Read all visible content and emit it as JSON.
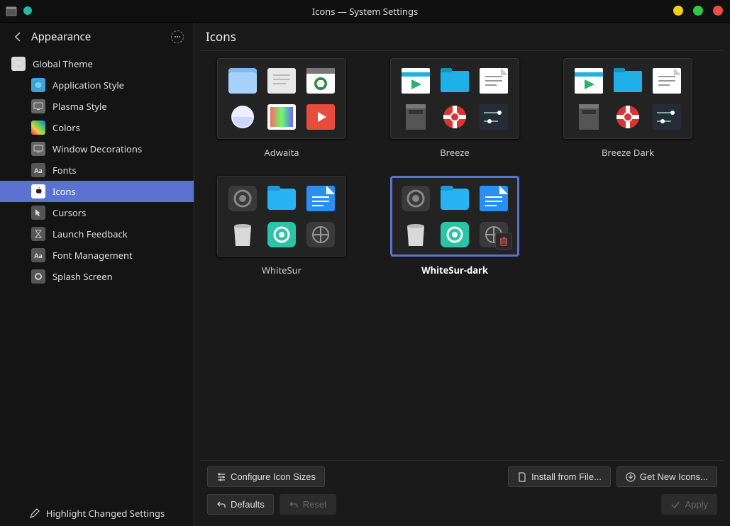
{
  "window": {
    "title": "Icons — System Settings",
    "buttons": {
      "minimize_color": "#f2ce1b",
      "maximize_color": "#33c748",
      "close_color": "#ee4b43"
    }
  },
  "sidebar": {
    "header_title": "Appearance",
    "footer_label": "Highlight Changed Settings",
    "items": [
      {
        "id": "global-theme",
        "label": "Global Theme",
        "child": false,
        "icon": "monitor"
      },
      {
        "id": "application-style",
        "label": "Application Style",
        "child": true,
        "icon": "cube"
      },
      {
        "id": "plasma-style",
        "label": "Plasma Style",
        "child": true,
        "icon": "monitor-gray"
      },
      {
        "id": "colors",
        "label": "Colors",
        "child": true,
        "icon": "rainbow"
      },
      {
        "id": "window-decorations",
        "label": "Window Decorations",
        "child": true,
        "icon": "monitor-gray"
      },
      {
        "id": "fonts",
        "label": "Fonts",
        "child": true,
        "icon": "aa"
      },
      {
        "id": "icons",
        "label": "Icons",
        "child": true,
        "icon": "apple",
        "selected": true
      },
      {
        "id": "cursors",
        "label": "Cursors",
        "child": true,
        "icon": "cursor"
      },
      {
        "id": "launch-feedback",
        "label": "Launch Feedback",
        "child": true,
        "icon": "hourglass"
      },
      {
        "id": "font-management",
        "label": "Font Management",
        "child": true,
        "icon": "aa"
      },
      {
        "id": "splash-screen",
        "label": "Splash Screen",
        "child": true,
        "icon": "gear"
      }
    ]
  },
  "content": {
    "title": "Icons",
    "themes": [
      {
        "id": "adwaita",
        "label": "Adwaita",
        "selected": false,
        "deletable": false
      },
      {
        "id": "breeze",
        "label": "Breeze",
        "selected": false,
        "deletable": false
      },
      {
        "id": "breeze-dark",
        "label": "Breeze Dark",
        "selected": false,
        "deletable": false
      },
      {
        "id": "whitesur",
        "label": "WhiteSur",
        "selected": false,
        "deletable": false
      },
      {
        "id": "whitesur-dark",
        "label": "WhiteSur-dark",
        "selected": true,
        "deletable": true
      }
    ]
  },
  "footer": {
    "configure_sizes": "Configure Icon Sizes",
    "install_from_file": "Install from File...",
    "get_new": "Get New Icons...",
    "defaults": "Defaults",
    "reset": "Reset",
    "apply": "Apply"
  }
}
